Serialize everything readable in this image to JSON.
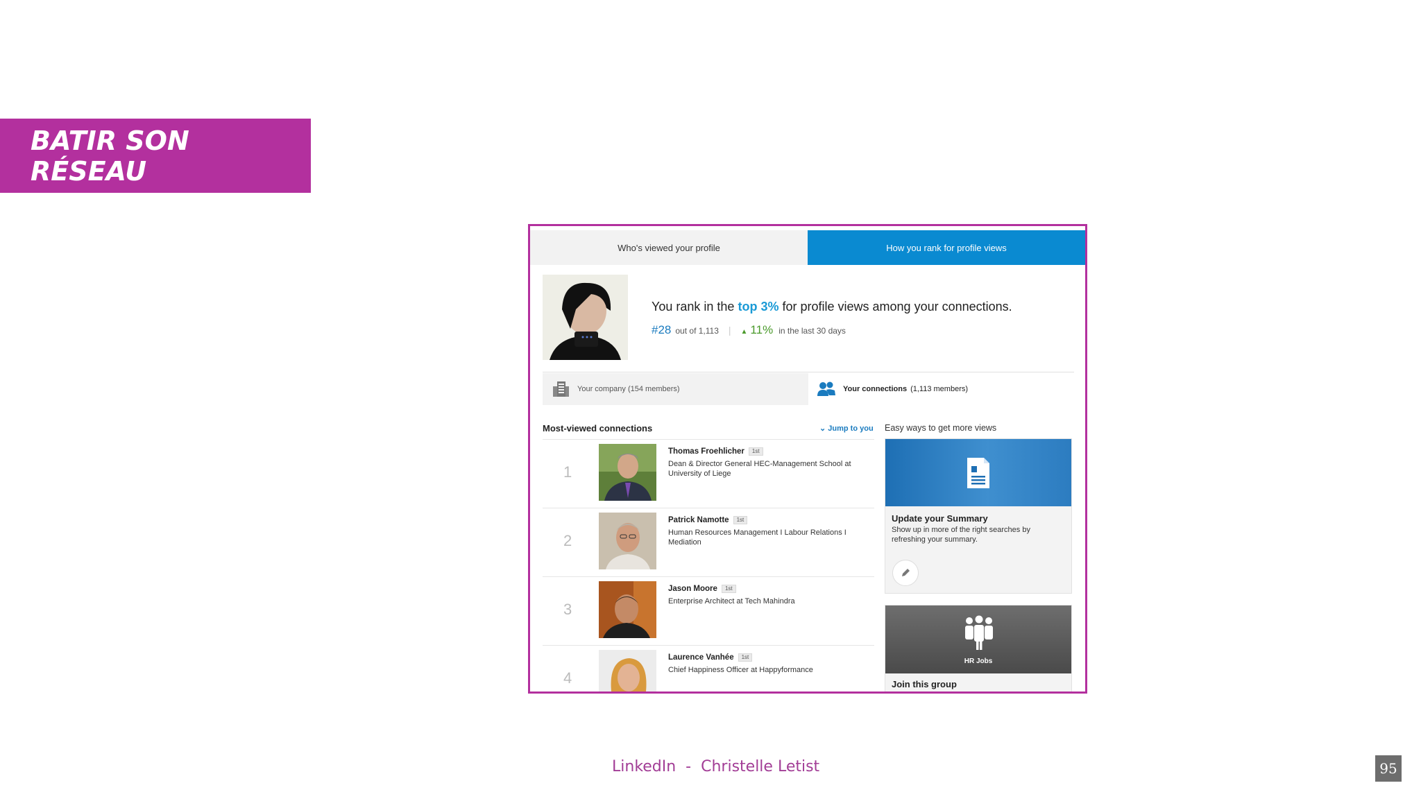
{
  "slide": {
    "title": "BATIR SON RÉSEAU",
    "footer": "LinkedIn  -  Christelle Letist",
    "page_number": "95",
    "accent_color": "#b3309e"
  },
  "tabs": {
    "left": "Who's viewed your profile",
    "right": "How you rank for profile views",
    "active_color": "#0a8ad1"
  },
  "rank": {
    "prefix": "You rank in the",
    "highlight": "top 3%",
    "suffix": "for profile views among your connections.",
    "position": "#28",
    "out_of": "out of 1,113",
    "change": "11%",
    "period": "in the last 30 days"
  },
  "filters": {
    "company": "Your company (154 members)",
    "connections_label": "Your connections",
    "connections_count": "(1,113 members)"
  },
  "list": {
    "title": "Most-viewed connections",
    "jump": "Jump to you",
    "items": [
      {
        "rank": "1",
        "name": "Thomas Froehlicher",
        "degree": "1st",
        "desc": "Dean & Director General HEC-Management School at University of Liege"
      },
      {
        "rank": "2",
        "name": "Patrick Namotte",
        "degree": "1st",
        "desc": "Human Resources Management I Labour Relations I Mediation"
      },
      {
        "rank": "3",
        "name": "Jason Moore",
        "degree": "1st",
        "desc": "Enterprise Architect at Tech Mahindra"
      },
      {
        "rank": "4",
        "name": "Laurence Vanhée",
        "degree": "1st",
        "desc": "Chief Happiness Officer at Happyformance"
      }
    ]
  },
  "tips": {
    "title": "Easy ways to get more views",
    "card1": {
      "title": "Update your Summary",
      "desc": "Show up in more of the right searches by refreshing your summary."
    },
    "card2": {
      "group_name": "HR Jobs",
      "title": "Join this group"
    }
  }
}
